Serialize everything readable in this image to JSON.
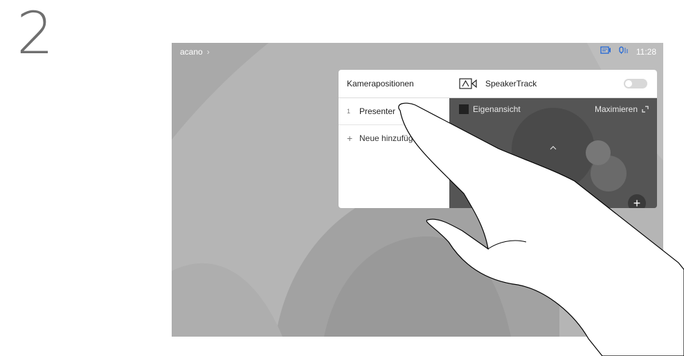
{
  "step": {
    "number": "2"
  },
  "topbar": {
    "breadcrumb": "acano",
    "breadcrumb_chevron": "›",
    "time": "11:28",
    "icons": [
      "screen-share-icon",
      "microphone-icon"
    ]
  },
  "camera_panel": {
    "presets_header": "Kamerapositionen",
    "presets": [
      {
        "index": "1",
        "label": "Presenter"
      }
    ],
    "add_label": "Neue hinzufügen",
    "speakertrack_label": "SpeakerTrack",
    "speakertrack_on": false,
    "selfview_label": "Eigenansicht",
    "maximize_label": "Maximieren",
    "zoom_in": "+",
    "zoom_out": "−"
  },
  "colors": {
    "accent": "#2a6cd6",
    "panel_dark": "#555555"
  }
}
